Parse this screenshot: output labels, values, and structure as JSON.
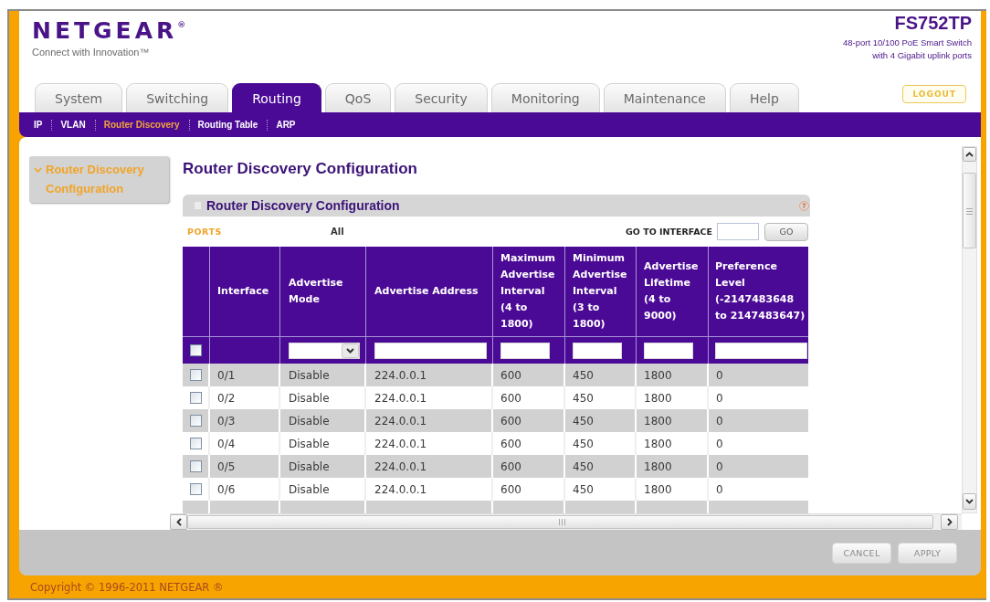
{
  "header": {
    "logo": "NETGEAR$^{®}$",
    "tagline": "Connect with Innovation™",
    "model": "FS752TP",
    "description": [
      "48-port 10/100 PoE Smart Switch",
      "with 4 Gigabit uplink ports"
    ]
  },
  "tabs": [
    {
      "label": "System",
      "selected": false
    },
    {
      "label": "Switching",
      "selected": false
    },
    {
      "label": "Routing",
      "selected": true
    },
    {
      "label": "QoS",
      "selected": false
    },
    {
      "label": "Security",
      "selected": false
    },
    {
      "label": "Monitoring",
      "selected": false
    },
    {
      "label": "Maintenance",
      "selected": false
    },
    {
      "label": "Help",
      "selected": false
    }
  ],
  "logout_button": "LOGOUT",
  "subnav": [
    {
      "label": "IP",
      "selected": false
    },
    {
      "label": "VLAN",
      "selected": false
    },
    {
      "label": "Router Discovery",
      "selected": true
    },
    {
      "label": "Routing Table",
      "selected": false
    },
    {
      "label": "ARP",
      "selected": false
    }
  ],
  "sidebar": {
    "items": [
      {
        "label": "Router Discovery Configuration",
        "selected": true
      }
    ]
  },
  "page_title": "Router Discovery Configuration",
  "panel": {
    "title": "Router Discovery Configuration",
    "help": "?",
    "ports_label": "PORTS",
    "ports_value": "All",
    "goto_label": "GO TO INTERFACE",
    "goto_button": "GO"
  },
  "table": {
    "columns": [
      "Interface",
      "Advertise Mode",
      "Advertise Address",
      "Maximum Advertise Interval (4 to 1800)",
      "Minimum Advertise Interval (3 to 1800)",
      "Advertise Lifetime (4 to 9000)",
      "Preference Level (-2147483648 to 2147483647)"
    ],
    "select_all": {
      "checked": false
    },
    "filters": [
      {
        "kind": "none"
      },
      {
        "kind": "select"
      },
      {
        "kind": "text"
      },
      {
        "kind": "text"
      },
      {
        "kind": "text"
      },
      {
        "kind": "text"
      },
      {
        "kind": "text"
      }
    ],
    "rows": [
      {
        "checked": false,
        "cells": [
          "0/1",
          "Disable",
          "224.0.0.1",
          "600",
          "450",
          "1800",
          "0"
        ]
      },
      {
        "checked": false,
        "cells": [
          "0/2",
          "Disable",
          "224.0.0.1",
          "600",
          "450",
          "1800",
          "0"
        ]
      },
      {
        "checked": false,
        "cells": [
          "0/3",
          "Disable",
          "224.0.0.1",
          "600",
          "450",
          "1800",
          "0"
        ]
      },
      {
        "checked": false,
        "cells": [
          "0/4",
          "Disable",
          "224.0.0.1",
          "600",
          "450",
          "1800",
          "0"
        ]
      },
      {
        "checked": false,
        "cells": [
          "0/5",
          "Disable",
          "224.0.0.1",
          "600",
          "450",
          "1800",
          "0"
        ]
      },
      {
        "checked": false,
        "cells": [
          "0/6",
          "Disable",
          "224.0.0.1",
          "600",
          "450",
          "1800",
          "0"
        ]
      }
    ]
  },
  "buttons": [
    "CANCEL",
    "APPLY"
  ],
  "footer": "Copyright © 1996-2011 NETGEAR ®"
}
